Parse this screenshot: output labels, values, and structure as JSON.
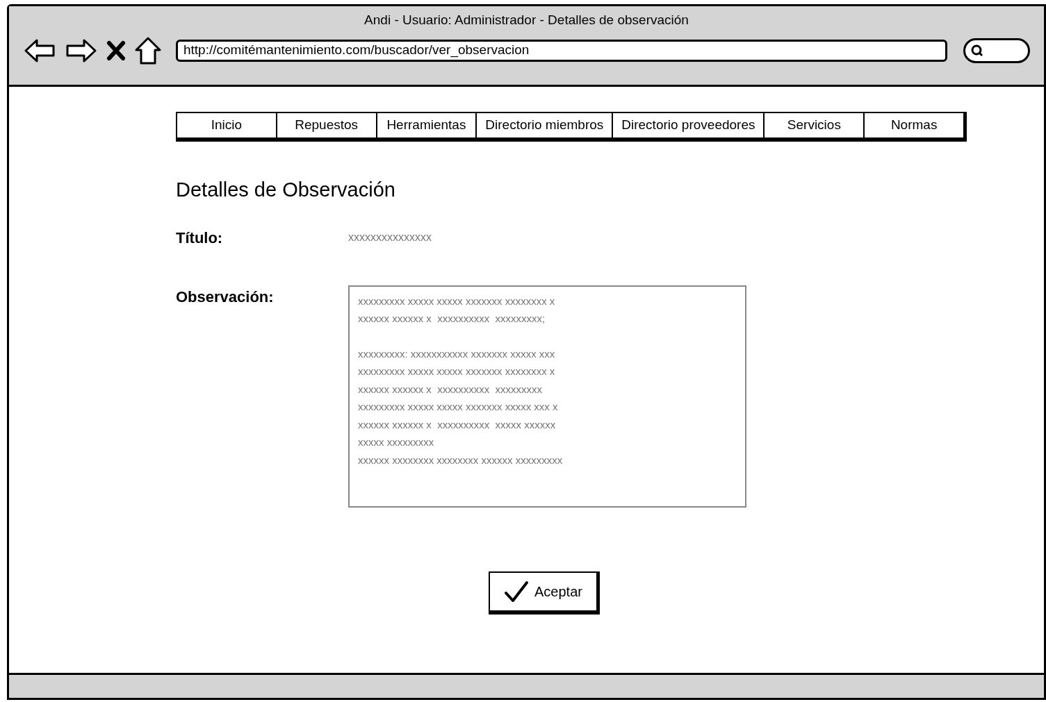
{
  "window": {
    "title": "Andi - Usuario: Administrador - Detalles de observación"
  },
  "address_bar": {
    "value": "http://comitémantenimiento.com/buscador/ver_observacion"
  },
  "tabs": [
    "Inicio",
    "Repuestos",
    "Herramientas",
    "Directorio miembros",
    "Directorio proveedores",
    "Servicios",
    "Normas"
  ],
  "heading": "Detalles de Observación",
  "fields": [
    {
      "label": "Título:",
      "value": "xxxxxxxxxxxxxxx"
    }
  ],
  "observation": {
    "label": "Observación:",
    "paragraphs": [
      [
        "xxxxxxxxx xxxxx xxxxx xxxxxxx xxxxxxxx x",
        "xxxxxx xxxxxx x  xxxxxxxxxx  xxxxxxxxx;"
      ],
      [
        "xxxxxxxxx: xxxxxxxxxxx xxxxxxx xxxxx xxx",
        "xxxxxxxxx xxxxx xxxxx xxxxxxx xxxxxxxx x",
        "xxxxxx xxxxxx x  xxxxxxxxxx  xxxxxxxxx",
        "xxxxxxxxx xxxxx xxxxx xxxxxxx xxxxx xxx x",
        "xxxxxx xxxxxx x  xxxxxxxxxx  xxxxx xxxxxx",
        "xxxxx xxxxxxxxx",
        "xxxxxx xxxxxxxx xxxxxxxx xxxxxx xxxxxxxxx"
      ]
    ]
  },
  "button": "Aceptar"
}
